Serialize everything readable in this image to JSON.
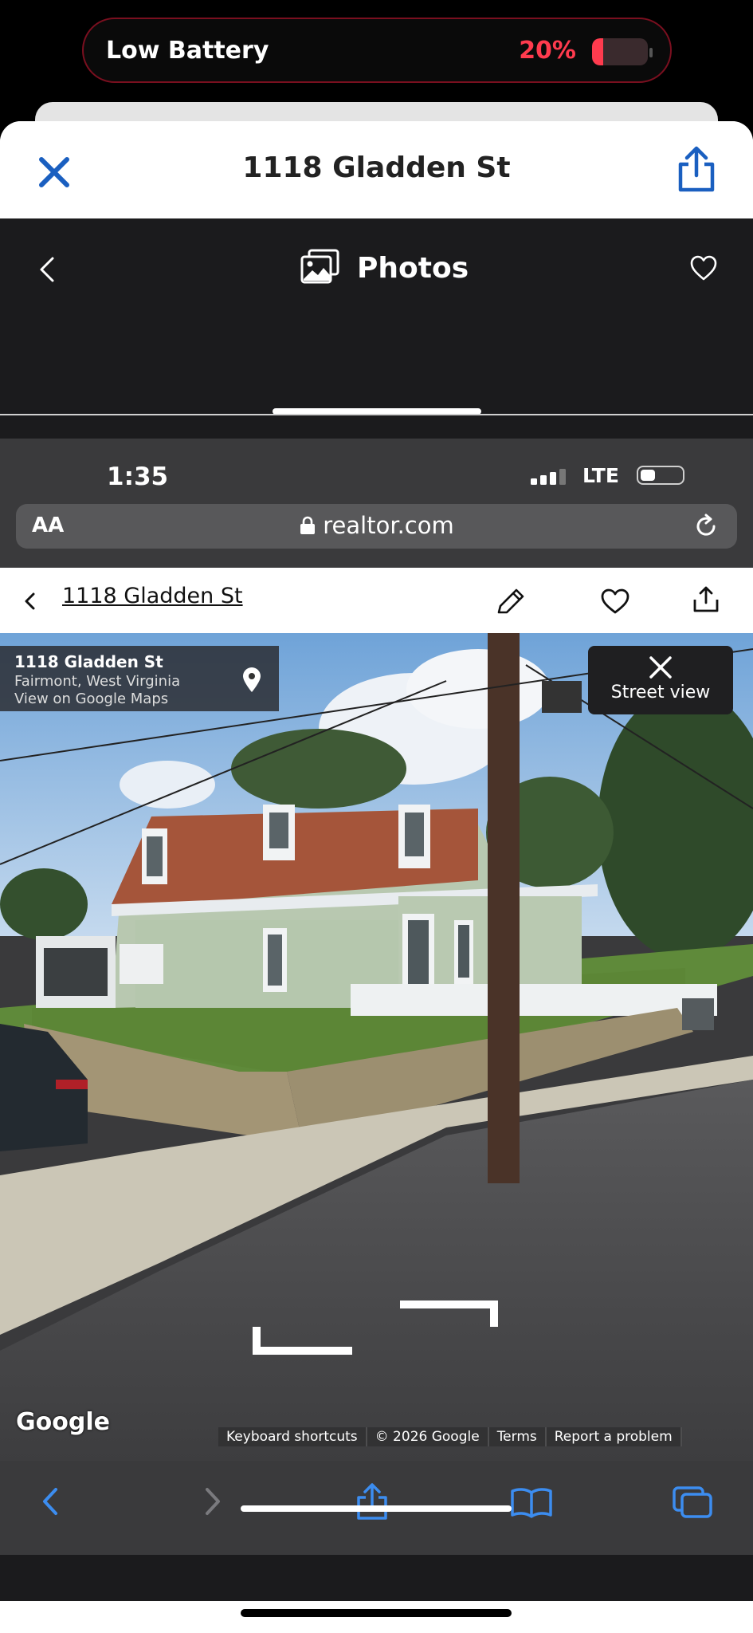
{
  "battery_banner": {
    "label": "Low Battery",
    "percent": "20%",
    "level": 0.2
  },
  "sheet": {
    "title": "1118 Gladden St"
  },
  "photos_bar": {
    "tab_label": "Photos"
  },
  "screenshot": {
    "status_bar": {
      "time": "1:35",
      "network": "LTE"
    },
    "url_bar": {
      "aa_label": "AA",
      "url": "realtor.com"
    },
    "page_header": {
      "title": "1118 Gladden St"
    },
    "street_view": {
      "address_card": {
        "line1": "1118 Gladden St",
        "line2": "Fairmont, West Virginia",
        "link": "View on Google Maps"
      },
      "close_label": "Street view",
      "google_logo": "Google",
      "attribution": [
        "Keyboard shortcuts",
        "© 2026 Google",
        "Terms",
        "Report a problem"
      ]
    }
  },
  "icons": [
    "close-icon",
    "share-icon",
    "chevron-left-icon",
    "photos-icon",
    "heart-icon",
    "lock-icon",
    "reload-icon",
    "pencil-icon",
    "pin-icon",
    "forward-icon",
    "bookmarks-icon",
    "tabs-icon"
  ],
  "colors": {
    "accent": "#1a5fc0",
    "battery_red": "#ff3b4e",
    "dark_bar": "#1b1b1d"
  }
}
